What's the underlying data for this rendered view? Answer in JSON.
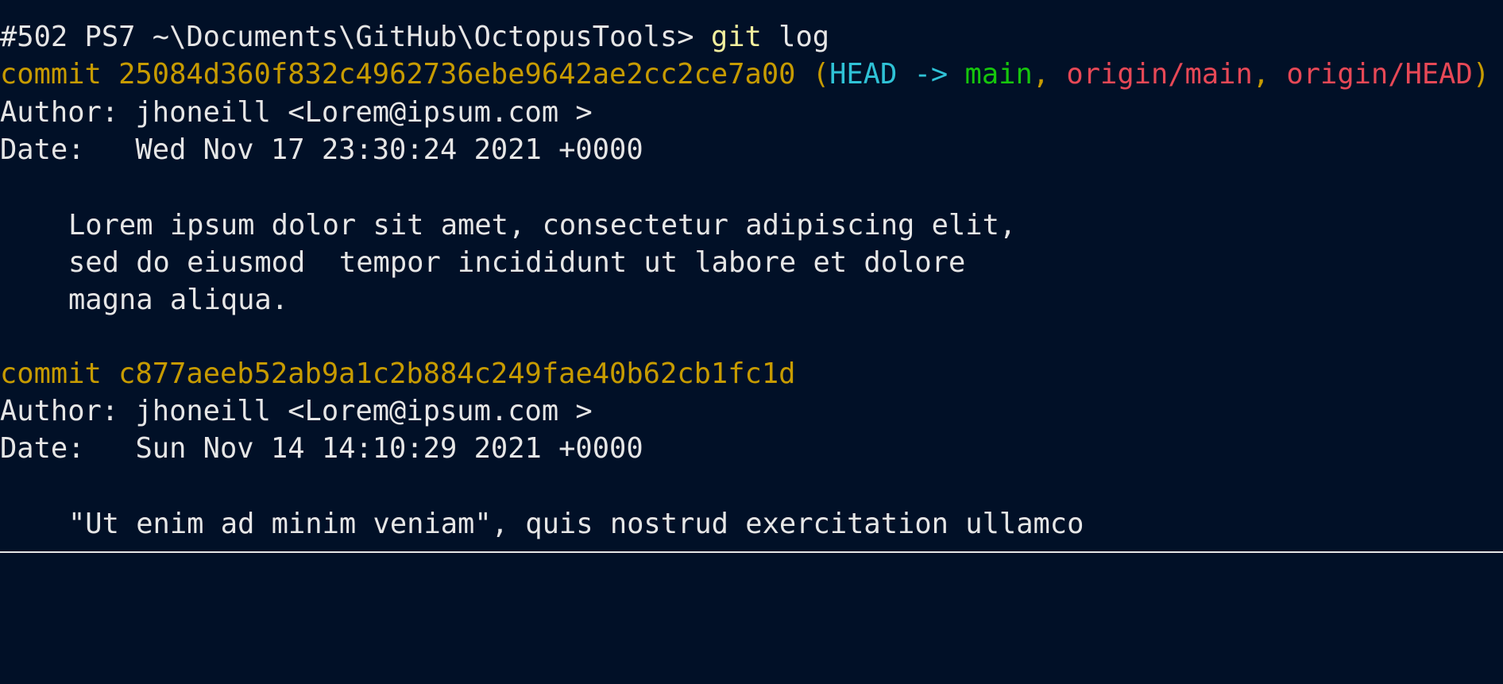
{
  "terminal": {
    "prompt": "#502 PS7 ~\\Documents\\GitHub\\OctopusTools>",
    "command": "git",
    "argument": "log"
  },
  "commits": [
    {
      "commit_label": "commit",
      "hash": "25084d360f832c4962736ebe9642ae2cc2ce7a00",
      "ref_open": "(",
      "head": "HEAD",
      "arrow": "->",
      "local_branch": "main",
      "separator_1": ",",
      "remote_branch_1": "origin/main",
      "separator_2": ",",
      "remote_branch_2": "origin/HEAD",
      "ref_close": ")",
      "author_line": "Author: jhoneill <Lorem@ipsum.com >",
      "date_line": "Date:   Wed Nov 17 23:30:24 2021 +0000",
      "message_lines": [
        "Lorem ipsum dolor sit amet, consectetur adipiscing elit,",
        "sed do eiusmod  tempor incididunt ut labore et dolore",
        "magna aliqua."
      ]
    },
    {
      "commit_label": "commit",
      "hash": "c877aeeb52ab9a1c2b884c249fae40b62cb1fc1d",
      "author_line": "Author: jhoneill <Lorem@ipsum.com >",
      "date_line": "Date:   Sun Nov 14 14:10:29 2021 +0000",
      "message_lines": [
        "\"Ut enim ad minim veniam\", quis nostrud exercitation ullamco"
      ]
    }
  ],
  "colors": {
    "background": "#011027",
    "default_text": "#e6e6e6",
    "command": "#f3ef9e",
    "commit_hash": "#c79b00",
    "head": "#2fc2d6",
    "local_branch": "#16c60c",
    "remote_branch": "#e74856"
  }
}
